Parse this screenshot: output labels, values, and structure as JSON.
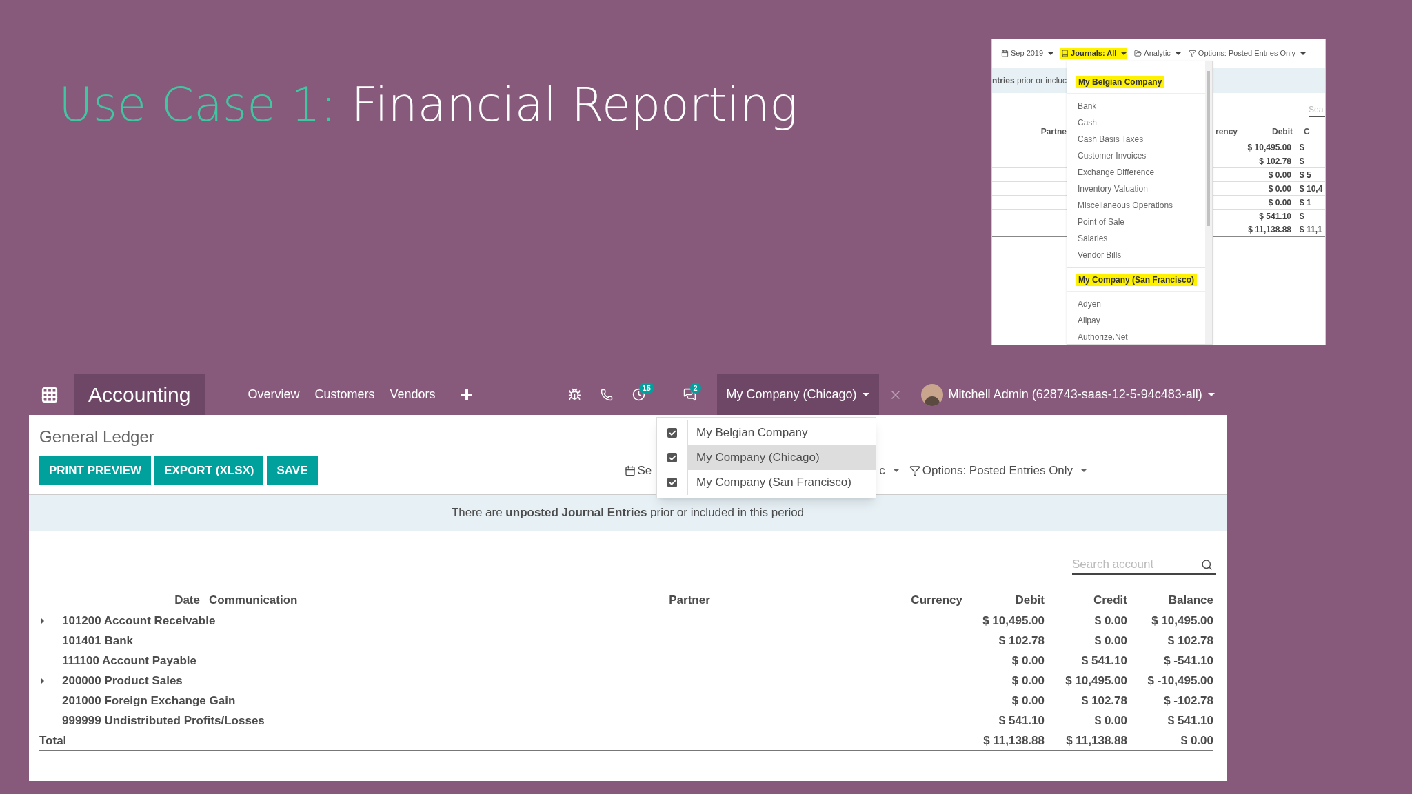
{
  "slide_title": {
    "prefix": "Use Case 1:",
    "text": "Financial Reporting"
  },
  "inset": {
    "toolbar": [
      {
        "kind": "date",
        "label": "Sep 2019",
        "highlighted": false
      },
      {
        "kind": "journals",
        "label": "Journals: All",
        "highlighted": true
      },
      {
        "kind": "analytic",
        "label": "Analytic",
        "highlighted": false
      },
      {
        "kind": "options",
        "label": "Options: Posted Entries Only",
        "highlighted": false
      }
    ],
    "notice": "**ntries** prior or incluc",
    "search_placeholder": "Sea",
    "columns": [
      "Partne",
      "rency",
      "Debit",
      "C"
    ],
    "rows": [
      {
        "kind": "line",
        "debit": "$ 10,495.00",
        "column_4": "$"
      },
      {
        "kind": "line",
        "debit": "$ 102.78",
        "column_4": "$"
      },
      {
        "kind": "line",
        "debit": "$ 0.00",
        "column_4": "$ 5"
      },
      {
        "kind": "line",
        "debit": "$ 0.00",
        "column_4": "$ 10,4"
      },
      {
        "kind": "line",
        "debit": "$ 0.00",
        "column_4": "$ 1"
      },
      {
        "kind": "line",
        "debit": "$ 541.10",
        "column_4": "$"
      },
      {
        "kind": "total",
        "debit": "$ 11,138.88",
        "column_4": "$ 11,1"
      }
    ],
    "journals_menu": [
      {
        "company": "My Belgian Company",
        "highlighted": true,
        "journals": [
          "Bank",
          "Cash",
          "Cash Basis Taxes",
          "Customer Invoices",
          "Exchange Difference",
          "Inventory Valuation",
          "Miscellaneous Operations",
          "Point of Sale",
          "Salaries",
          "Vendor Bills"
        ]
      },
      {
        "company": "My Company (San Francisco)",
        "highlighted": true,
        "journals": [
          "Adyen",
          "Alipay",
          "Authorize.Net"
        ]
      }
    ]
  },
  "navbar": {
    "app_name": "Accounting",
    "menu": [
      "Overview",
      "Customers",
      "Vendors"
    ],
    "activity_count": "15",
    "message_count": "2",
    "company": "My Company (Chicago)",
    "user": "Mitchell Admin (628743-saas-12-5-94c483-all)"
  },
  "company_menu": [
    {
      "label": "My Belgian Company",
      "checked": true,
      "selected": false
    },
    {
      "label": "My Company (Chicago)",
      "checked": true,
      "selected": true
    },
    {
      "label": "My Company (San Francisco)",
      "checked": true,
      "selected": false
    }
  ],
  "report": {
    "title": "General Ledger",
    "buttons": [
      "PRINT PREVIEW",
      "EXPORT (XLSX)",
      "SAVE"
    ],
    "filters": [
      {
        "kind": "date",
        "label": "Se"
      },
      {
        "kind": "analytic",
        "label": "c"
      },
      {
        "kind": "options",
        "label": "Options: Posted Entries Only"
      }
    ],
    "notice": "There are **unposted Journal Entries** prior or included in this period",
    "search": {
      "placeholder": "Search account"
    },
    "columns": [
      "Date",
      "Communication",
      "Partner",
      "Currency",
      "Debit",
      "Credit",
      "Balance"
    ],
    "rows": [
      {
        "account": "101200 Account Receivable",
        "expandable": true,
        "debit": "$ 10,495.00",
        "credit": "$ 0.00",
        "balance": "$ 10,495.00"
      },
      {
        "account": "101401 Bank",
        "expandable": false,
        "debit": "$ 102.78",
        "credit": "$ 0.00",
        "balance": "$ 102.78"
      },
      {
        "account": "111100 Account Payable",
        "expandable": false,
        "debit": "$ 0.00",
        "credit": "$ 541.10",
        "balance": "$ -541.10"
      },
      {
        "account": "200000 Product Sales",
        "expandable": true,
        "debit": "$ 0.00",
        "credit": "$ 10,495.00",
        "balance": "$ -10,495.00"
      },
      {
        "account": "201000 Foreign Exchange Gain",
        "expandable": false,
        "debit": "$ 0.00",
        "credit": "$ 102.78",
        "balance": "$ -102.78"
      },
      {
        "account": "999999 Undistributed Profits/Losses",
        "expandable": false,
        "debit": "$ 541.10",
        "credit": "$ 0.00",
        "balance": "$ 541.10"
      }
    ],
    "total": {
      "label": "Total",
      "debit": "$ 11,138.88",
      "credit": "$ 11,138.88",
      "balance": "$ 0.00"
    }
  }
}
